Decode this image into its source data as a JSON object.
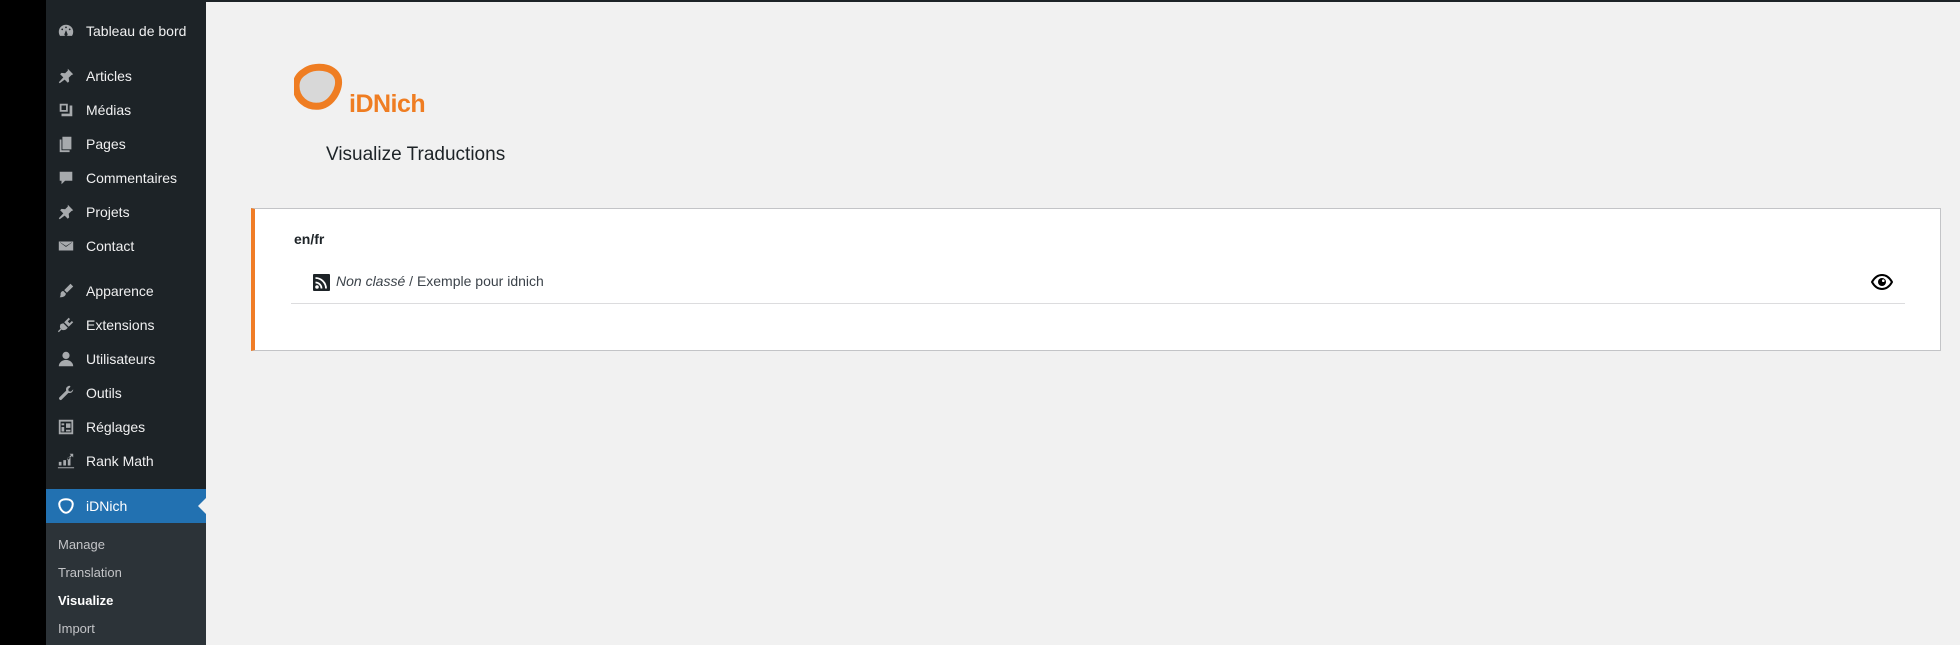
{
  "sidebar": {
    "items": [
      {
        "label": "Tableau de bord",
        "icon": "dashboard-icon"
      },
      {
        "label": "Articles",
        "icon": "pin-icon"
      },
      {
        "label": "Médias",
        "icon": "media-icon"
      },
      {
        "label": "Pages",
        "icon": "pages-icon"
      },
      {
        "label": "Commentaires",
        "icon": "comment-icon"
      },
      {
        "label": "Projets",
        "icon": "pin-icon"
      },
      {
        "label": "Contact",
        "icon": "mail-icon"
      },
      {
        "label": "Apparence",
        "icon": "brush-icon"
      },
      {
        "label": "Extensions",
        "icon": "plugin-icon"
      },
      {
        "label": "Utilisateurs",
        "icon": "user-icon"
      },
      {
        "label": "Outils",
        "icon": "wrench-icon"
      },
      {
        "label": "Réglages",
        "icon": "settings-icon"
      },
      {
        "label": "Rank Math",
        "icon": "chart-icon"
      },
      {
        "label": "iDNich",
        "icon": "idnich-icon",
        "active": true
      }
    ],
    "submenu": [
      {
        "label": "Manage"
      },
      {
        "label": "Translation"
      },
      {
        "label": "Visualize",
        "current": true
      },
      {
        "label": "Import"
      }
    ]
  },
  "logo": {
    "text": "iDNich"
  },
  "page": {
    "title": "Visualize Traductions"
  },
  "card": {
    "lang_pair": "en/fr",
    "rows": [
      {
        "category": "Non classé",
        "separator": " / ",
        "title": "Exemple pour idnich",
        "icon": "rss-icon",
        "action_icon": "eye-icon"
      }
    ]
  },
  "colors": {
    "sidebar_bg": "#1d2327",
    "active_bg": "#2271b1",
    "accent": "#f07c26",
    "page_bg": "#f1f1f1"
  }
}
